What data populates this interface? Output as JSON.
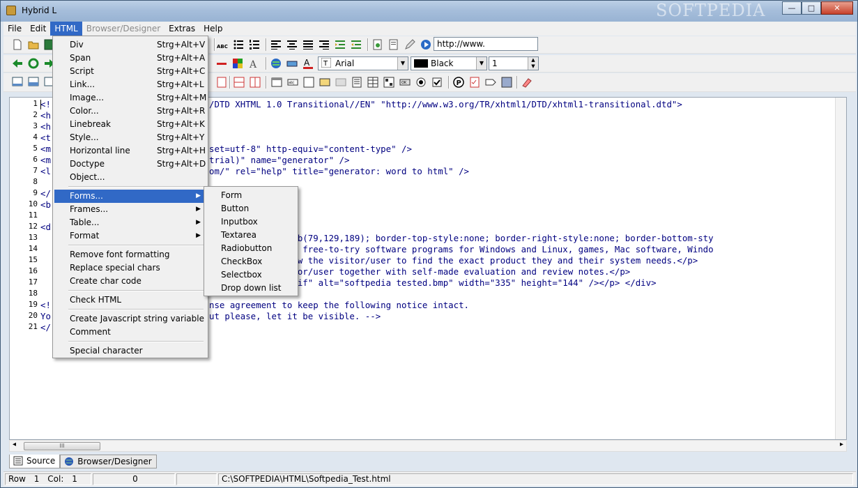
{
  "window": {
    "title": "Hybrid L",
    "watermark": "SOFTPEDIA",
    "controls": {
      "minimize": "—",
      "maximize": "□",
      "close": "✕"
    }
  },
  "menubar": [
    "File",
    "Edit",
    "HTML",
    "Browser/Designer",
    "Extras",
    "Help"
  ],
  "toolbar": {
    "url_value": "http://www.",
    "font_value": "Arial",
    "color_value": "Black",
    "size_value": "1"
  },
  "editor": {
    "line_numbers": [
      "1",
      "2",
      "3",
      "4",
      "5",
      "6",
      "7",
      "8",
      "9",
      "10",
      "11",
      "12",
      "13",
      "14",
      "15",
      "16",
      "17",
      "18",
      "19",
      "20",
      "21"
    ],
    "lines": [
      {
        "prefix": "<!",
        "tail": "/DTD XHTML 1.0 Transitional//EN\" \"http://www.w3.org/TR/xhtml1/DTD/xhtml1-transitional.dtd\">"
      },
      {
        "prefix": "<h",
        "tail": ""
      },
      {
        "prefix": "<h",
        "tail": ""
      },
      {
        "prefix": "<t",
        "tail": ""
      },
      {
        "prefix": "<m",
        "tail": "set=utf-8\" http-equiv=\"content-type\" />"
      },
      {
        "prefix": "<m",
        "tail": "trial)\" name=\"generator\" />"
      },
      {
        "prefix": "<l",
        "tail": "om/\" rel=\"help\" title=\"generator: word to html\" />"
      },
      {
        "prefix": "",
        "tail": ""
      },
      {
        "prefix": "</",
        "tail": ""
      },
      {
        "prefix": "<b",
        "tail": ""
      },
      {
        "prefix": "",
        "tail": ""
      },
      {
        "prefix": "<d",
        "tail": ""
      },
      {
        "prefix": "",
        "tail": "r-bottom-color:rgb(79,129,189); border-top-style:none; border-right-style:none; border-bottom-sty"
      },
      {
        "prefix": "",
        "tail": ",000,000 free and free-to-try software programs for Windows and Linux, games, Mac software, Windo"
      },
      {
        "prefix": "",
        "tail": " in order to allow the visitor/user to find the exact product they and their system needs.</p>"
      },
      {
        "prefix": "",
        "tail": "ucts to the visitor/user together with self-made evaluation and review notes.</p>"
      },
      {
        "prefix": "",
        "tail": "_files/image002.gif\" alt=\"softpedia tested.bmp\" width=\"335\" height=\"144\" /></p> </div>"
      },
      {
        "prefix": "",
        "tail": ""
      },
      {
        "prefix": "<!",
        "tail": "nse agreement to keep the following notice intact."
      },
      {
        "prefix": "Yo",
        "tail": "ut please, let it be visible. -->"
      },
      {
        "prefix": "</",
        "tail": ""
      }
    ]
  },
  "html_menu": {
    "group1": [
      {
        "label": "Div",
        "shortcut": "Strg+Alt+V"
      },
      {
        "label": "Span",
        "shortcut": "Strg+Alt+A"
      },
      {
        "label": "Script",
        "shortcut": "Strg+Alt+C"
      },
      {
        "label": "Link...",
        "shortcut": "Strg+Alt+L"
      },
      {
        "label": "Image...",
        "shortcut": "Strg+Alt+M"
      },
      {
        "label": "Color...",
        "shortcut": "Strg+Alt+R"
      },
      {
        "label": "Linebreak",
        "shortcut": "Strg+Alt+K"
      },
      {
        "label": "Style...",
        "shortcut": "Strg+Alt+Y"
      },
      {
        "label": "Horizontal line",
        "shortcut": "Strg+Alt+H"
      },
      {
        "label": "Doctype",
        "shortcut": "Strg+Alt+D"
      },
      {
        "label": "Object...",
        "shortcut": ""
      }
    ],
    "group2": [
      "Forms...",
      "Frames...",
      "Table...",
      "Format"
    ],
    "group3": [
      "Remove font formatting",
      "Replace special chars",
      "Create char code"
    ],
    "group4": [
      "Check HTML"
    ],
    "group5": [
      "Create Javascript string variable",
      "Comment"
    ],
    "group6": [
      "Special character"
    ],
    "submenu_arrow": "▶"
  },
  "forms_submenu": [
    "Form",
    "Button",
    "Inputbox",
    "Textarea",
    "Radiobutton",
    "CheckBox",
    "Selectbox",
    "Drop down list"
  ],
  "tabs": [
    "Source",
    "Browser/Designer"
  ],
  "status": {
    "row_label": "Row",
    "row": "1",
    "col_label": "Col:",
    "col": "1",
    "count": "0",
    "path": "C:\\SOFTPEDIA\\HTML\\Softpedia_Test.html"
  },
  "scroll": {
    "grip": "III",
    "left_arrow": "◂",
    "right_arrow": "▸"
  },
  "colors": {
    "tag": "#000080",
    "string": "#0000ff",
    "menu_highlight": "#3169c6",
    "title_gradient": "#a6bedb"
  }
}
